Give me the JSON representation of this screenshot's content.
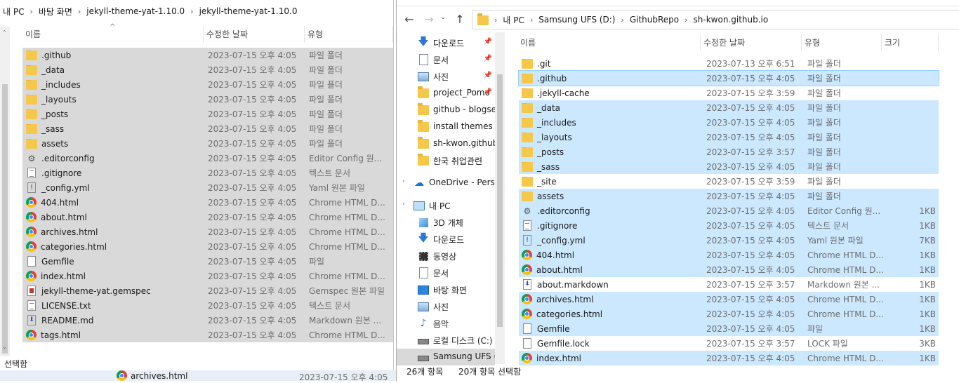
{
  "left_window": {
    "breadcrumb": [
      "내 PC",
      "바탕 화면",
      "jekyll-theme-yat-1.10.0",
      "jekyll-theme-yat-1.10.0"
    ],
    "columns": [
      "이름",
      "수정한 날짜",
      "유형"
    ],
    "files": [
      {
        "name": ".github",
        "date": "2023-07-15 오후 4:05",
        "type": "파일 폴더",
        "icon": "folder-icon"
      },
      {
        "name": "_data",
        "date": "2023-07-15 오후 4:05",
        "type": "파일 폴더",
        "icon": "folder-icon"
      },
      {
        "name": "_includes",
        "date": "2023-07-15 오후 4:05",
        "type": "파일 폴더",
        "icon": "folder-icon"
      },
      {
        "name": "_layouts",
        "date": "2023-07-15 오후 4:05",
        "type": "파일 폴더",
        "icon": "folder-icon"
      },
      {
        "name": "_posts",
        "date": "2023-07-15 오후 4:05",
        "type": "파일 폴더",
        "icon": "folder-icon"
      },
      {
        "name": "_sass",
        "date": "2023-07-15 오후 4:05",
        "type": "파일 폴더",
        "icon": "folder-icon"
      },
      {
        "name": "assets",
        "date": "2023-07-15 오후 4:05",
        "type": "파일 폴더",
        "icon": "folder-icon"
      },
      {
        "name": ".editorconfig",
        "date": "2023-07-15 오후 4:05",
        "type": "Editor Config 원...",
        "icon": "gear-file-icon"
      },
      {
        "name": ".gitignore",
        "date": "2023-07-15 오후 4:05",
        "type": "텍스트 문서",
        "icon": "text-file-icon"
      },
      {
        "name": "_config.yml",
        "date": "2023-07-15 오후 4:05",
        "type": "Yaml 원본 파일",
        "icon": "yaml-file-icon"
      },
      {
        "name": "404.html",
        "date": "2023-07-15 오후 4:05",
        "type": "Chrome HTML D...",
        "icon": "chrome-icon"
      },
      {
        "name": "about.html",
        "date": "2023-07-15 오후 4:05",
        "type": "Chrome HTML D...",
        "icon": "chrome-icon"
      },
      {
        "name": "archives.html",
        "date": "2023-07-15 오후 4:05",
        "type": "Chrome HTML D...",
        "icon": "chrome-icon"
      },
      {
        "name": "categories.html",
        "date": "2023-07-15 오후 4:05",
        "type": "Chrome HTML D...",
        "icon": "chrome-icon"
      },
      {
        "name": "Gemfile",
        "date": "2023-07-15 오후 4:05",
        "type": "파일",
        "icon": "blank-file-icon"
      },
      {
        "name": "index.html",
        "date": "2023-07-15 오후 4:05",
        "type": "Chrome HTML D...",
        "icon": "chrome-icon"
      },
      {
        "name": "jekyll-theme-yat.gemspec",
        "date": "2023-07-15 오후 4:05",
        "type": "Gemspec 원본 파일",
        "icon": "gemspec-file-icon"
      },
      {
        "name": "LICENSE.txt",
        "date": "2023-07-15 오후 4:05",
        "type": "텍스트 문서",
        "icon": "text-file-icon"
      },
      {
        "name": "README.md",
        "date": "2023-07-15 오후 4:05",
        "type": "Markdown 원본 ...",
        "icon": "markdown-file-icon"
      },
      {
        "name": "tags.html",
        "date": "2023-07-15 오후 4:05",
        "type": "Chrome HTML D...",
        "icon": "chrome-icon"
      }
    ],
    "status": "선택함",
    "drag_ghost": {
      "name": "archives.html",
      "date": "2023-07-15 오후 4:05"
    }
  },
  "right_window": {
    "breadcrumb": [
      "내 PC",
      "Samsung UFS (D:)",
      "GithubRepo",
      "sh-kwon.github.io"
    ],
    "nav": [
      {
        "label": "다운로드",
        "icon": "download-icon",
        "pinned": true
      },
      {
        "label": "문서",
        "icon": "document-icon",
        "pinned": true
      },
      {
        "label": "사진",
        "icon": "picture-icon",
        "pinned": true
      },
      {
        "label": "project_Pomo",
        "icon": "folder-icon",
        "pinned": true
      },
      {
        "label": "github - blogset",
        "icon": "folder-icon",
        "pinned": false
      },
      {
        "label": "install themes",
        "icon": "folder-icon",
        "pinned": false
      },
      {
        "label": "sh-kwon.github.",
        "icon": "folder-icon",
        "pinned": false
      },
      {
        "label": "한국 취업관련",
        "icon": "folder-icon",
        "pinned": false
      },
      {
        "label": "OneDrive - Person",
        "icon": "cloud-icon",
        "pinned": false
      },
      {
        "label": "내 PC",
        "icon": "computer-icon",
        "pinned": false
      },
      {
        "label": "3D 개체",
        "icon": "cube-icon",
        "pinned": false
      },
      {
        "label": "다운로드",
        "icon": "download-icon",
        "pinned": false
      },
      {
        "label": "동영상",
        "icon": "video-icon",
        "pinned": false
      },
      {
        "label": "문서",
        "icon": "document-icon",
        "pinned": false
      },
      {
        "label": "바탕 화면",
        "icon": "desktop-icon",
        "pinned": false
      },
      {
        "label": "사진",
        "icon": "picture-icon",
        "pinned": false
      },
      {
        "label": "음악",
        "icon": "music-icon",
        "pinned": false
      },
      {
        "label": "로컬 디스크 (C:)",
        "icon": "drive-icon",
        "pinned": false
      },
      {
        "label": "Samsung UFS (D",
        "icon": "drive-icon",
        "pinned": false
      }
    ],
    "columns": [
      "이름",
      "수정한 날짜",
      "유형",
      "크기"
    ],
    "files": [
      {
        "name": ".git",
        "date": "2023-07-13 오후 6:51",
        "type": "파일 폴더",
        "size": "",
        "icon": "folder-icon",
        "selected": false
      },
      {
        "name": ".github",
        "date": "2023-07-15 오후 4:05",
        "type": "파일 폴더",
        "size": "",
        "icon": "folder-icon",
        "selected": true
      },
      {
        "name": ".jekyll-cache",
        "date": "2023-07-15 오후 3:59",
        "type": "파일 폴더",
        "size": "",
        "icon": "folder-icon",
        "selected": false
      },
      {
        "name": "_data",
        "date": "2023-07-15 오후 4:05",
        "type": "파일 폴더",
        "size": "",
        "icon": "folder-icon",
        "selected": true
      },
      {
        "name": "_includes",
        "date": "2023-07-15 오후 4:05",
        "type": "파일 폴더",
        "size": "",
        "icon": "folder-icon",
        "selected": true
      },
      {
        "name": "_layouts",
        "date": "2023-07-15 오후 4:05",
        "type": "파일 폴더",
        "size": "",
        "icon": "folder-icon",
        "selected": true
      },
      {
        "name": "_posts",
        "date": "2023-07-15 오후 3:57",
        "type": "파일 폴더",
        "size": "",
        "icon": "folder-icon",
        "selected": true
      },
      {
        "name": "_sass",
        "date": "2023-07-15 오후 4:05",
        "type": "파일 폴더",
        "size": "",
        "icon": "folder-icon",
        "selected": true
      },
      {
        "name": "_site",
        "date": "2023-07-15 오후 3:59",
        "type": "파일 폴더",
        "size": "",
        "icon": "folder-icon",
        "selected": false
      },
      {
        "name": "assets",
        "date": "2023-07-15 오후 4:05",
        "type": "파일 폴더",
        "size": "",
        "icon": "folder-icon",
        "selected": true
      },
      {
        "name": ".editorconfig",
        "date": "2023-07-15 오후 4:05",
        "type": "Editor Config 원...",
        "size": "1KB",
        "icon": "gear-file-icon",
        "selected": true
      },
      {
        "name": ".gitignore",
        "date": "2023-07-15 오후 4:05",
        "type": "텍스트 문서",
        "size": "1KB",
        "icon": "text-file-icon",
        "selected": true
      },
      {
        "name": "_config.yml",
        "date": "2023-07-15 오후 4:05",
        "type": "Yaml 원본 파일",
        "size": "7KB",
        "icon": "yaml-file-icon",
        "selected": true
      },
      {
        "name": "404.html",
        "date": "2023-07-15 오후 4:05",
        "type": "Chrome HTML D...",
        "size": "1KB",
        "icon": "chrome-icon",
        "selected": true
      },
      {
        "name": "about.html",
        "date": "2023-07-15 오후 4:05",
        "type": "Chrome HTML D...",
        "size": "1KB",
        "icon": "chrome-icon",
        "selected": true
      },
      {
        "name": "about.markdown",
        "date": "2023-07-15 오후 3:57",
        "type": "Markdown 원본 ...",
        "size": "1KB",
        "icon": "markdown-file-icon",
        "selected": false
      },
      {
        "name": "archives.html",
        "date": "2023-07-15 오후 4:05",
        "type": "Chrome HTML D...",
        "size": "1KB",
        "icon": "chrome-icon",
        "selected": true
      },
      {
        "name": "categories.html",
        "date": "2023-07-15 오후 4:05",
        "type": "Chrome HTML D...",
        "size": "1KB",
        "icon": "chrome-icon",
        "selected": true
      },
      {
        "name": "Gemfile",
        "date": "2023-07-15 오후 4:05",
        "type": "파일",
        "size": "1KB",
        "icon": "blank-file-icon",
        "selected": true
      },
      {
        "name": "Gemfile.lock",
        "date": "2023-07-15 오후 3:57",
        "type": "LOCK 파일",
        "size": "3KB",
        "icon": "blank-file-icon",
        "selected": false
      },
      {
        "name": "index.html",
        "date": "2023-07-15 오후 4:05",
        "type": "Chrome HTML D...",
        "size": "1KB",
        "icon": "chrome-icon",
        "selected": true
      }
    ],
    "status_count": "26개 항목",
    "status_selected": "20개 항목 선택함"
  }
}
